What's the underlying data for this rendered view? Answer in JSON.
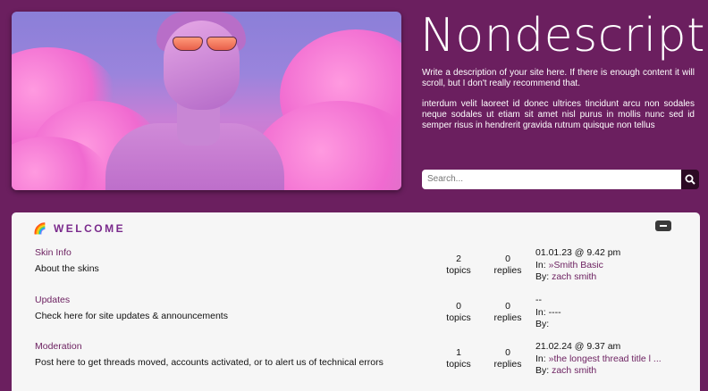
{
  "header": {
    "site_title": "Nondescript",
    "description_1": "Write a description of your site here. If there is enough content it will scroll, but I don't really recommend that.",
    "description_2": "interdum velit laoreet id donec ultrices tincidunt arcu non sodales neque sodales ut etiam sit amet nisl purus in mollis nunc sed id semper risus in hendrerit gravida rutrum quisque non tellus",
    "search_placeholder": "Search...",
    "colors": {
      "background": "#6b1f5f",
      "search_button": "#2c0a24",
      "link": "#6b1f5f"
    }
  },
  "category": {
    "icon": "🌈",
    "title": "WELCOME",
    "forums": [
      {
        "name": "Skin Info",
        "description": "About the skins",
        "topics": "2",
        "topics_label": "topics",
        "replies": "0",
        "replies_label": "replies",
        "last_date": "01.01.23 @ 9.42 pm",
        "last_in_label": "In:",
        "last_in": "»Smith Basic",
        "last_by_label": "By:",
        "last_by": "zach smith"
      },
      {
        "name": "Updates",
        "description": "Check here for site updates & announcements",
        "topics": "0",
        "topics_label": "topics",
        "replies": "0",
        "replies_label": "replies",
        "last_date": "--",
        "last_in_label": "In:",
        "last_in": "----",
        "last_by_label": "By:",
        "last_by": ""
      },
      {
        "name": "Moderation",
        "description": "Post here to get threads moved, accounts activated, or to alert us of technical errors",
        "topics": "1",
        "topics_label": "topics",
        "replies": "0",
        "replies_label": "replies",
        "last_date": "21.02.24 @ 9.37 am",
        "last_in_label": "In:",
        "last_in": "»the longest thread title l ...",
        "last_by_label": "By:",
        "last_by": "zach smith"
      }
    ]
  }
}
